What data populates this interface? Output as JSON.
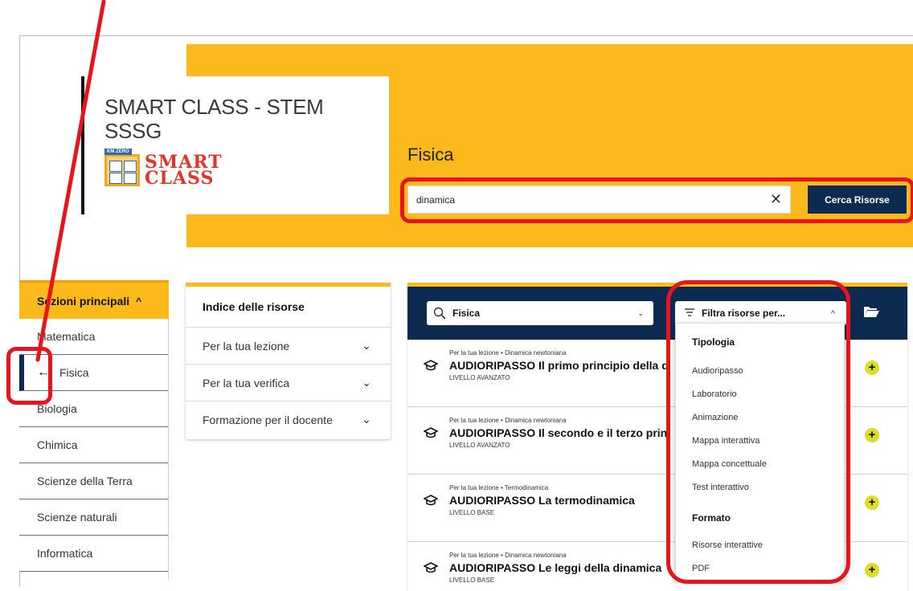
{
  "header": {
    "site_title": "SMART CLASS - STEM SSSG",
    "logo": {
      "badge": "KM ZERO",
      "line1": "SMART",
      "line2": "CLASS"
    },
    "section_title": "Fisica"
  },
  "search": {
    "value": "dinamica",
    "clear_icon": "close-icon",
    "button_label": "Cerca Risorse"
  },
  "sidebar": {
    "title": "Sezioni principali",
    "items": [
      {
        "label": "Matematica",
        "active": false
      },
      {
        "label": "Fisica",
        "active": true
      },
      {
        "label": "Biologia",
        "active": false
      },
      {
        "label": "Chimica",
        "active": false
      },
      {
        "label": "Scienze della Terra",
        "active": false
      },
      {
        "label": "Scienze naturali",
        "active": false
      },
      {
        "label": "Informatica",
        "active": false
      }
    ]
  },
  "index": {
    "title": "Indice delle risorse",
    "items": [
      {
        "label": "Per la tua lezione"
      },
      {
        "label": "Per la tua verifica"
      },
      {
        "label": "Formazione per il docente"
      }
    ]
  },
  "results": {
    "subject_value": "Fisica",
    "filter_label": "Filtra risorse per...",
    "rows": [
      {
        "crumb": "Per la tua lezione • Dinamica newtoniana",
        "title": "AUDIORIPASSO Il primo principio della d",
        "level": "LIVELLO AVANZATO"
      },
      {
        "crumb": "Per la tua lezione • Dinamica newtoniana",
        "title": "AUDIORIPASSO Il secondo e il terzo prin",
        "level": "LIVELLO AVANZATO"
      },
      {
        "crumb": "Per la tua lezione • Termodinamica",
        "title": "AUDIORIPASSO La termodinamica",
        "level": "LIVELLO BASE"
      },
      {
        "crumb": "Per la tua lezione • Dinamica newtoniana",
        "title": "AUDIORIPASSO Le leggi della dinamica",
        "level": "LIVELLO BASE"
      }
    ]
  },
  "filter_dropdown": {
    "groups": [
      {
        "heading": "Tipologia",
        "options": [
          "Audioripasso",
          "Laboratorio",
          "Animazione",
          "Mappa interattiva",
          "Mappa concettuale",
          "Test interattivo"
        ]
      },
      {
        "heading": "Formato",
        "options": [
          "Risorse interattive",
          "PDF"
        ]
      }
    ]
  },
  "colors": {
    "accent_yellow": "#fbb91c",
    "navy": "#0d2b50",
    "annotation_red": "#e8141c",
    "add_button": "#d9de2b"
  }
}
